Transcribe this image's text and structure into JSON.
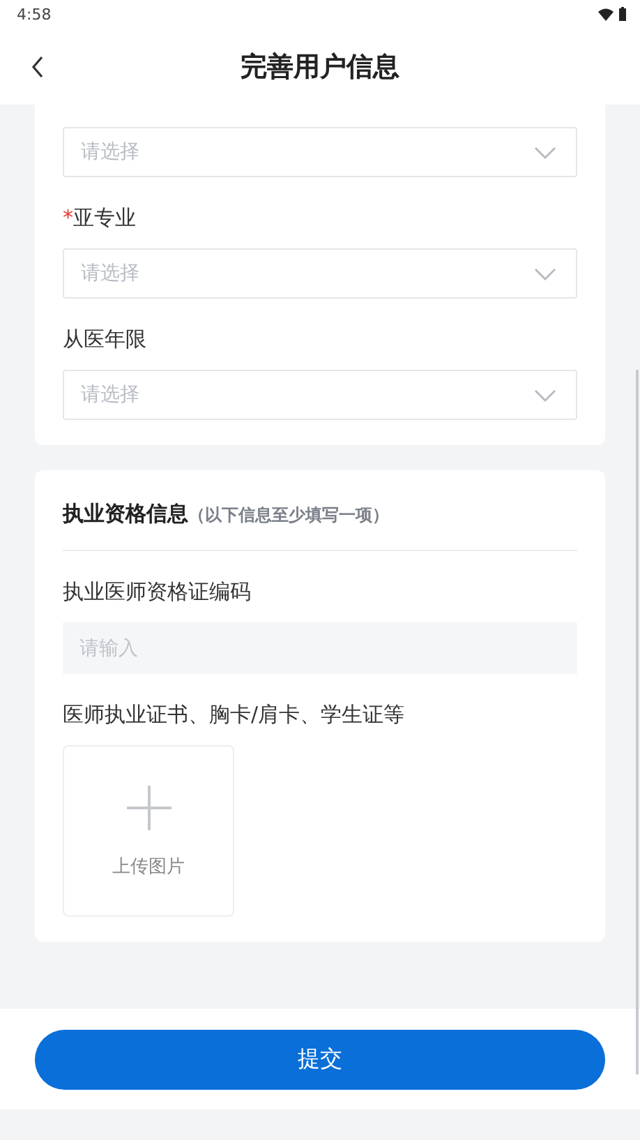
{
  "status_bar": {
    "time": "4:58"
  },
  "header": {
    "title": "完善用户信息"
  },
  "basic_fields": [
    {
      "placeholder": "请选择"
    },
    {
      "required_mark": "*",
      "label": "亚专业",
      "placeholder": "请选择"
    },
    {
      "label": "从医年限",
      "placeholder": "请选择"
    }
  ],
  "qualification": {
    "title": "执业资格信息",
    "note": "（以下信息至少填写一项）",
    "code_field": {
      "label": "执业医师资格证编码",
      "placeholder": "请输入"
    },
    "upload": {
      "label": "医师执业证书、胸卡/肩卡、学生证等",
      "button": "上传图片"
    }
  },
  "submit": "提交"
}
